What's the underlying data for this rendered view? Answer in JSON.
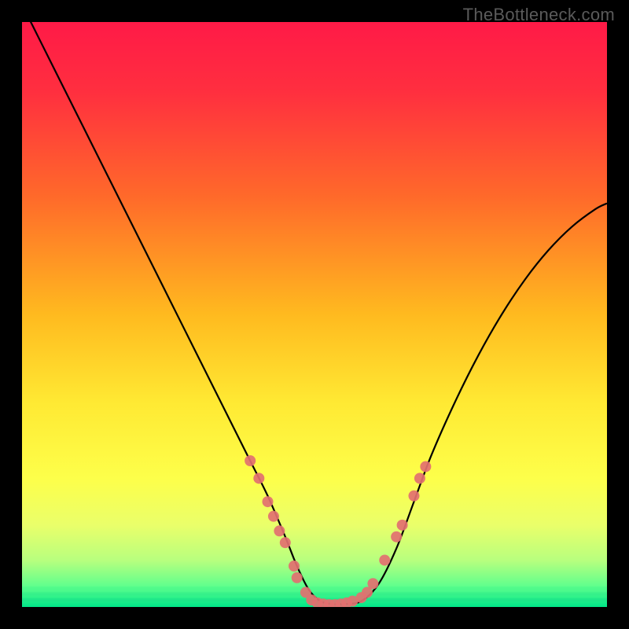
{
  "watermark": "TheBottleneck.com",
  "chart_data": {
    "type": "line",
    "title": "",
    "xlabel": "",
    "ylabel": "",
    "xlim": [
      0,
      100
    ],
    "ylim": [
      0,
      100
    ],
    "background_gradient": {
      "stops": [
        {
          "offset": 0.0,
          "color": "#ff1a47"
        },
        {
          "offset": 0.12,
          "color": "#ff2f3f"
        },
        {
          "offset": 0.3,
          "color": "#ff6a2a"
        },
        {
          "offset": 0.5,
          "color": "#ffba1f"
        },
        {
          "offset": 0.65,
          "color": "#ffe933"
        },
        {
          "offset": 0.78,
          "color": "#fdff4a"
        },
        {
          "offset": 0.86,
          "color": "#eaff6a"
        },
        {
          "offset": 0.92,
          "color": "#b8ff7e"
        },
        {
          "offset": 0.965,
          "color": "#5fff8d"
        },
        {
          "offset": 1.0,
          "color": "#00e688"
        }
      ]
    },
    "series": [
      {
        "name": "bottleneck-curve",
        "color": "#000000",
        "x": [
          0,
          3,
          6,
          9,
          12,
          15,
          18,
          21,
          24,
          27,
          30,
          33,
          36,
          39,
          42,
          45,
          47,
          49,
          51,
          53,
          55,
          58,
          61,
          64,
          67,
          70,
          74,
          78,
          82,
          86,
          90,
          94,
          98,
          100
        ],
        "y": [
          103,
          97,
          91,
          85,
          79,
          73,
          67,
          61,
          55,
          49,
          43,
          37,
          31,
          25,
          19,
          12,
          7,
          3,
          1,
          0.5,
          0.5,
          1,
          4,
          10,
          18,
          26,
          35,
          43,
          50,
          56,
          61,
          65,
          68,
          69
        ]
      }
    ],
    "markers": {
      "name": "highlight-points",
      "color": "#e27070",
      "radius": 7,
      "points": [
        {
          "x": 39,
          "y": 25
        },
        {
          "x": 40.5,
          "y": 22
        },
        {
          "x": 42,
          "y": 18
        },
        {
          "x": 43,
          "y": 15.5
        },
        {
          "x": 44,
          "y": 13
        },
        {
          "x": 45,
          "y": 11
        },
        {
          "x": 46.5,
          "y": 7
        },
        {
          "x": 47,
          "y": 5
        },
        {
          "x": 48.5,
          "y": 2.5
        },
        {
          "x": 49.5,
          "y": 1.2
        },
        {
          "x": 50.5,
          "y": 0.7
        },
        {
          "x": 51.5,
          "y": 0.5
        },
        {
          "x": 52.5,
          "y": 0.4
        },
        {
          "x": 53.5,
          "y": 0.4
        },
        {
          "x": 54.5,
          "y": 0.5
        },
        {
          "x": 55.5,
          "y": 0.7
        },
        {
          "x": 56.5,
          "y": 1
        },
        {
          "x": 58,
          "y": 1.6
        },
        {
          "x": 59,
          "y": 2.5
        },
        {
          "x": 60,
          "y": 4
        },
        {
          "x": 62,
          "y": 8
        },
        {
          "x": 64,
          "y": 12
        },
        {
          "x": 65,
          "y": 14
        },
        {
          "x": 67,
          "y": 19
        },
        {
          "x": 68,
          "y": 22
        },
        {
          "x": 69,
          "y": 24
        }
      ]
    }
  }
}
